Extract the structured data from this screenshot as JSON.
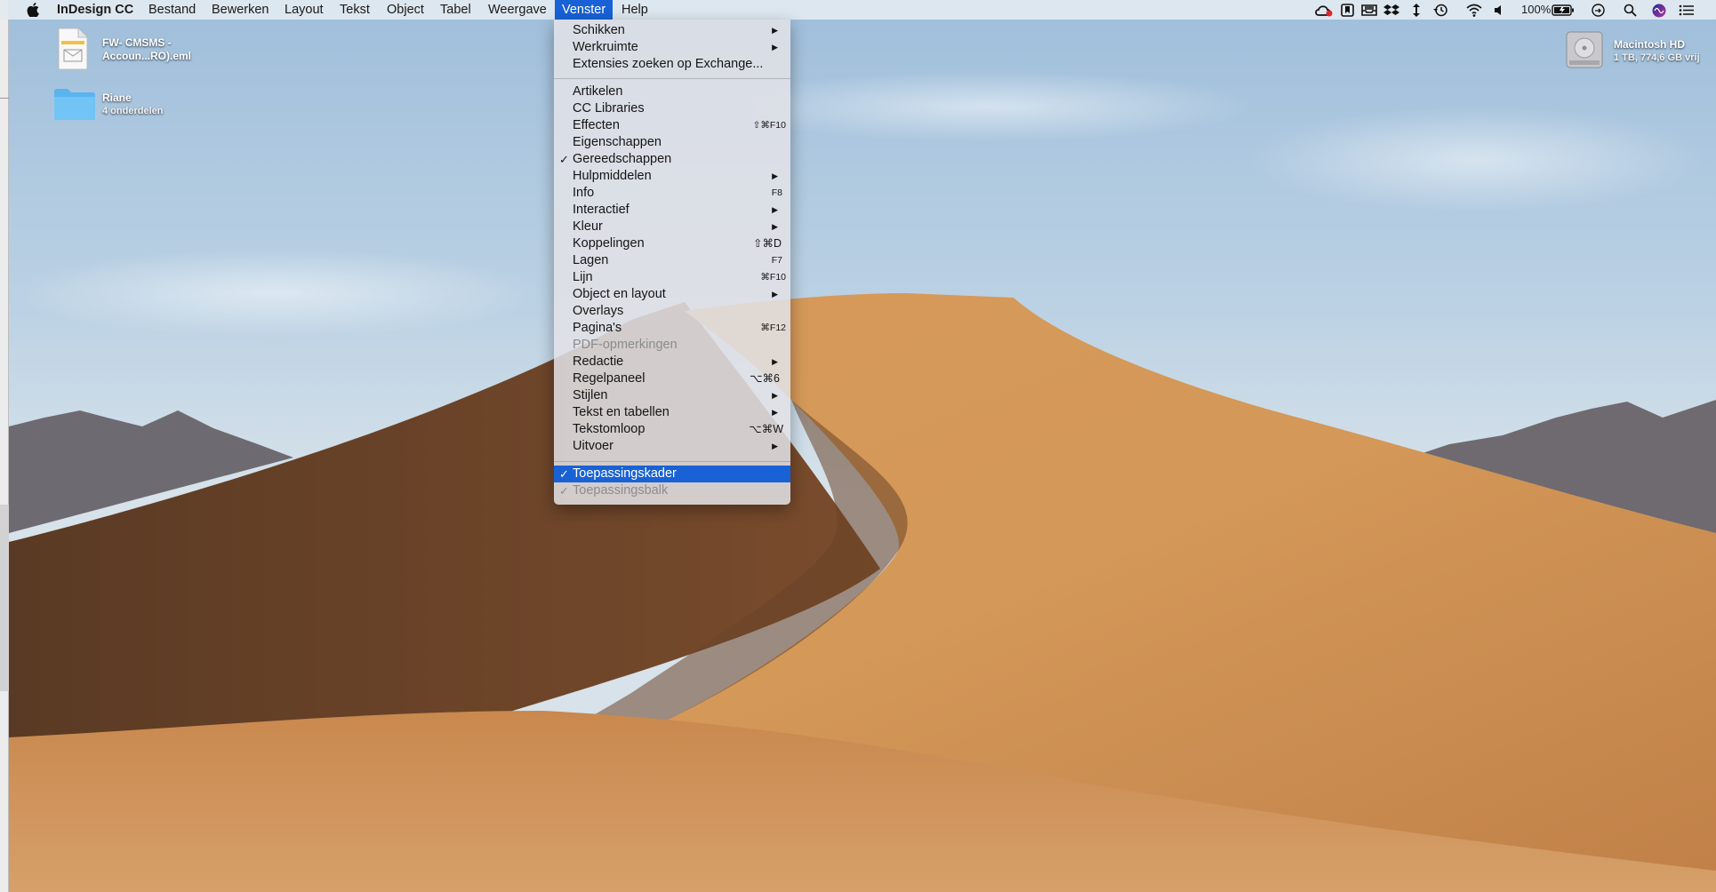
{
  "menubar": {
    "app_name": "InDesign CC",
    "menus": [
      "Bestand",
      "Bewerken",
      "Layout",
      "Tekst",
      "Object",
      "Tabel",
      "Weergave",
      "Venster",
      "Help"
    ],
    "active_menu": "Venster",
    "battery": "100%"
  },
  "desktop": {
    "items": [
      {
        "name": "FW- CMSMS -",
        "name2": "Accoun...RO).eml"
      },
      {
        "name": "Riane",
        "sub": "4 onderdelen"
      },
      {
        "name": "Macintosh HD",
        "sub": "1 TB, 774,6 GB vrij"
      }
    ]
  },
  "venster_menu": {
    "group1": [
      {
        "label": "Schikken",
        "submenu": true
      },
      {
        "label": "Werkruimte",
        "submenu": true
      },
      {
        "label": "Extensies zoeken op Exchange..."
      }
    ],
    "group2": [
      {
        "label": "Artikelen"
      },
      {
        "label": "CC Libraries"
      },
      {
        "label": "Effecten",
        "shortcut": "⇧⌘F10"
      },
      {
        "label": "Eigenschappen"
      },
      {
        "label": "Gereedschappen",
        "checked": true
      },
      {
        "label": "Hulpmiddelen",
        "submenu": true
      },
      {
        "label": "Info",
        "shortcut": "F8"
      },
      {
        "label": "Interactief",
        "submenu": true
      },
      {
        "label": "Kleur",
        "submenu": true
      },
      {
        "label": "Koppelingen",
        "shortcut": "⇧⌘D"
      },
      {
        "label": "Lagen",
        "shortcut": "F7"
      },
      {
        "label": "Lijn",
        "shortcut": "⌘F10"
      },
      {
        "label": "Object en layout",
        "submenu": true
      },
      {
        "label": "Overlays"
      },
      {
        "label": "Pagina's",
        "shortcut": "⌘F12"
      },
      {
        "label": "PDF-opmerkingen",
        "disabled": true
      },
      {
        "label": "Redactie",
        "submenu": true
      },
      {
        "label": "Regelpaneel",
        "shortcut": "⌥⌘6"
      },
      {
        "label": "Stijlen",
        "submenu": true
      },
      {
        "label": "Tekst en tabellen",
        "submenu": true
      },
      {
        "label": "Tekstomloop",
        "shortcut": "⌥⌘W"
      },
      {
        "label": "Uitvoer",
        "submenu": true
      }
    ],
    "group3": [
      {
        "label": "Toepassingskader",
        "checked": true,
        "selected": true
      },
      {
        "label": "Toepassingsbalk",
        "checked": true,
        "disabled": true
      }
    ],
    "check_glyph": "✓",
    "arrow_glyph": "▶"
  }
}
